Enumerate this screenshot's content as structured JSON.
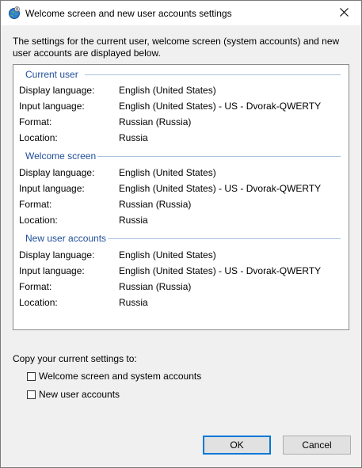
{
  "window": {
    "title": "Welcome screen and new user accounts settings"
  },
  "description": "The settings for the current user, welcome screen (system accounts) and new user accounts are displayed below.",
  "sections": [
    {
      "title": "Current user",
      "rows": [
        {
          "label": "Display language:",
          "value": "English (United States)"
        },
        {
          "label": "Input language:",
          "value": "English (United States) - US - Dvorak-QWERTY"
        },
        {
          "label": "Format:",
          "value": "Russian (Russia)"
        },
        {
          "label": "Location:",
          "value": "Russia"
        }
      ]
    },
    {
      "title": "Welcome screen",
      "rows": [
        {
          "label": "Display language:",
          "value": "English (United States)"
        },
        {
          "label": "Input language:",
          "value": "English (United States) - US - Dvorak-QWERTY"
        },
        {
          "label": "Format:",
          "value": "Russian (Russia)"
        },
        {
          "label": "Location:",
          "value": "Russia"
        }
      ]
    },
    {
      "title": "New user accounts",
      "rows": [
        {
          "label": "Display language:",
          "value": "English (United States)"
        },
        {
          "label": "Input language:",
          "value": "English (United States) - US - Dvorak-QWERTY"
        },
        {
          "label": "Format:",
          "value": "Russian (Russia)"
        },
        {
          "label": "Location:",
          "value": "Russia"
        }
      ]
    }
  ],
  "copy": {
    "label": "Copy your current settings to:",
    "options": [
      {
        "label": "Welcome screen and system accounts",
        "checked": false
      },
      {
        "label": "New user accounts",
        "checked": false
      }
    ]
  },
  "buttons": {
    "ok": "OK",
    "cancel": "Cancel"
  },
  "colors": {
    "section_title": "#1f4e9a",
    "default_button_border": "#0078d7"
  }
}
